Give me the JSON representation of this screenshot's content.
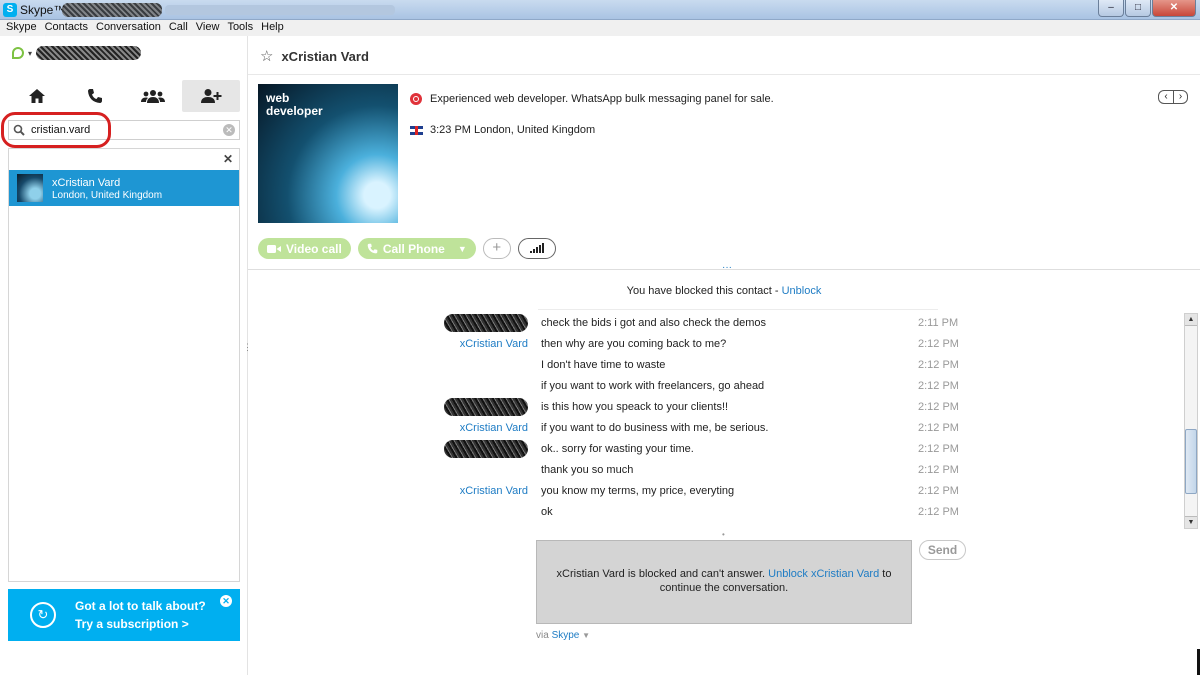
{
  "window": {
    "app_name": "Skype™",
    "controls": {
      "minimize": "–",
      "maximize": "□",
      "close": "✕"
    }
  },
  "menu": [
    "Skype",
    "Contacts",
    "Conversation",
    "Call",
    "View",
    "Tools",
    "Help"
  ],
  "sidebar": {
    "nav": [
      {
        "name": "home",
        "icon": "home-icon"
      },
      {
        "name": "call-phones",
        "icon": "phone-icon"
      },
      {
        "name": "new-group",
        "icon": "group-icon"
      },
      {
        "name": "add-contact",
        "icon": "add-contact-icon"
      }
    ],
    "search": {
      "value": "cristian.vard",
      "placeholder": ""
    },
    "close_results": "✕",
    "results": [
      {
        "name": "xCristian Vard",
        "location": "London, United Kingdom"
      }
    ],
    "promo": {
      "line1": "Got a lot to talk about?",
      "line2": "Try a subscription >",
      "close": "✕"
    }
  },
  "conversation": {
    "star": "☆",
    "title": "xCristian Vard",
    "profile_image_text": "web\ndeveloper",
    "mood": "Experienced web developer. WhatsApp bulk messaging panel for sale.",
    "local_time": "3:23 PM London, United Kingdom",
    "pager": {
      "prev": "‹",
      "next": "›"
    },
    "actions": {
      "video_call": "Video call",
      "call_phone": "Call Phone",
      "add": "+"
    },
    "expand_dots": "···",
    "blocked_notice": {
      "text": "You have blocked this contact - ",
      "link": "Unblock"
    },
    "messages": [
      {
        "sender": "",
        "redacted": true,
        "text": "check the bids i got and also check the demos",
        "time": "2:11 PM"
      },
      {
        "sender": "xCristian Vard",
        "redacted": false,
        "text": "then why are you coming back to me?",
        "time": "2:12 PM"
      },
      {
        "sender": "",
        "redacted": false,
        "text": "I don't have time to waste",
        "time": "2:12 PM"
      },
      {
        "sender": "",
        "redacted": false,
        "text": "if you want to work with freelancers, go ahead",
        "time": "2:12 PM"
      },
      {
        "sender": "",
        "redacted": true,
        "text": "is this how you speack to your clients!!",
        "time": "2:12 PM"
      },
      {
        "sender": "xCristian Vard",
        "redacted": false,
        "text": "if you want to do business with me, be serious.",
        "time": "2:12 PM"
      },
      {
        "sender": "",
        "redacted": true,
        "text": "ok.. sorry for wasting your time.",
        "time": "2:12 PM"
      },
      {
        "sender": "",
        "redacted": false,
        "text": "thank you so much",
        "time": "2:12 PM"
      },
      {
        "sender": "xCristian Vard",
        "redacted": false,
        "text": "you know my terms, my price, everyting",
        "time": "2:12 PM"
      },
      {
        "sender": "",
        "redacted": false,
        "text": "ok",
        "time": "2:12 PM"
      }
    ],
    "compose": {
      "blocked_prefix": "xCristian Vard is blocked and can't answer. ",
      "blocked_link": "Unblock xCristian Vard",
      "blocked_suffix": " to continue the conversation.",
      "send": "Send"
    },
    "via": {
      "prefix": "via ",
      "channel": "Skype"
    }
  }
}
